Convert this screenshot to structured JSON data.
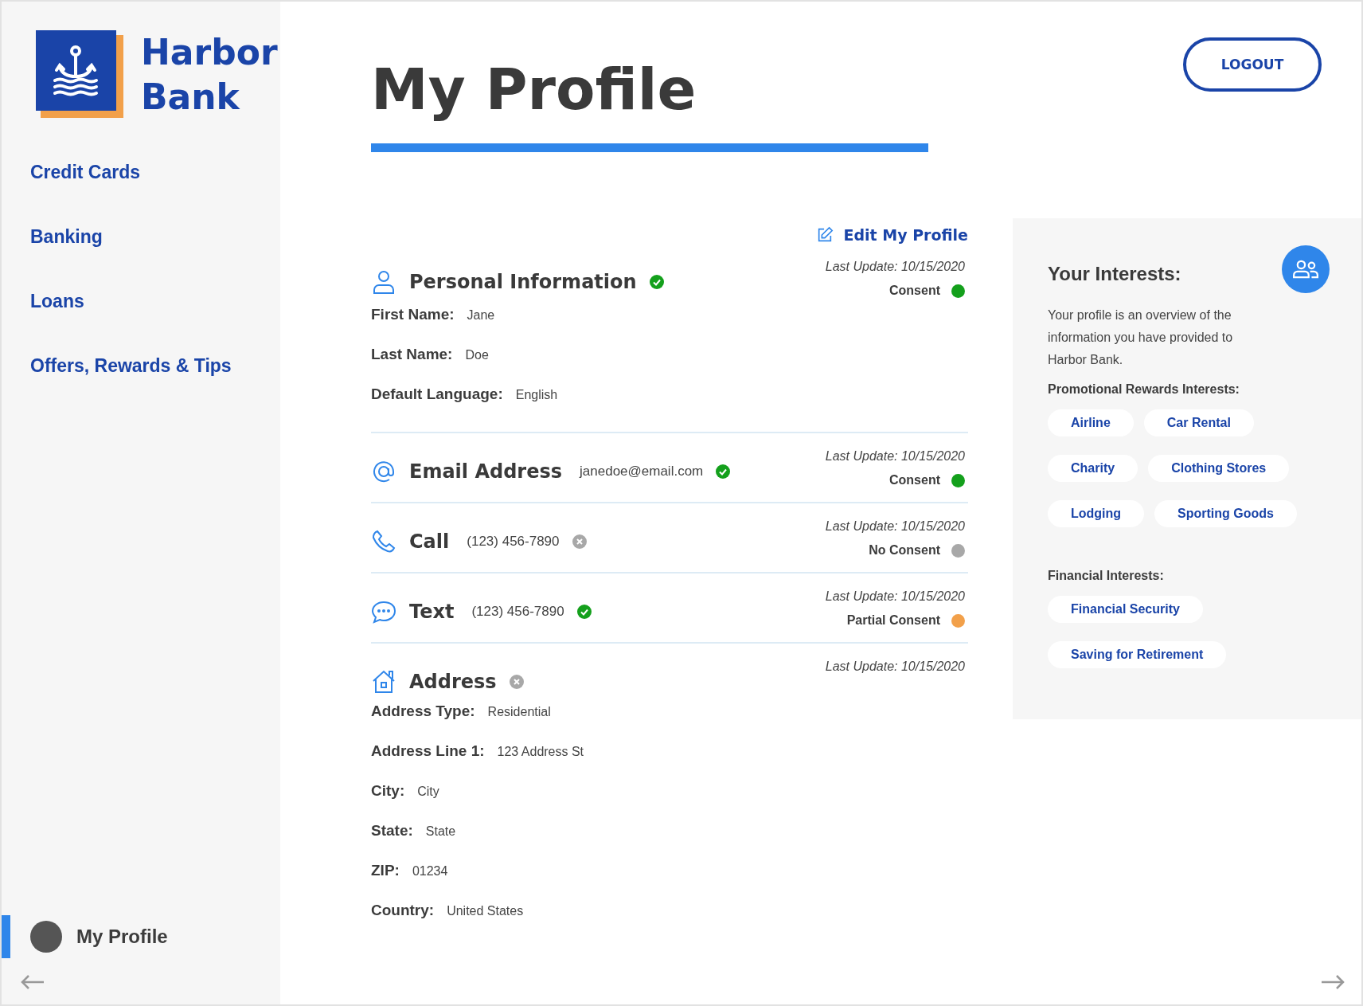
{
  "brand": {
    "name_line_1": "Harbor",
    "name_line_2": "Bank"
  },
  "nav": [
    {
      "label": "Credit Cards",
      "selected": false
    },
    {
      "label": "Banking",
      "selected": false
    },
    {
      "label": "Loans",
      "selected": false
    },
    {
      "label": "Offers, Rewards & Tips",
      "selected": false
    }
  ],
  "profile_link": {
    "label": "My Profile",
    "selected": true
  },
  "page_title": "My Profile",
  "logout_button": "LOGOUT",
  "edit_link": "Edit My Profile",
  "sections": [
    {
      "kind": "person",
      "title": "Personal Information",
      "verified": true,
      "last_update": "Last Update: 10/15/2020",
      "consent": {
        "label": "Consent",
        "color": "#14a01c"
      },
      "fields": [
        {
          "label": "First Name:",
          "value": "Jane"
        },
        {
          "label": "Last Name:",
          "value": "Doe"
        },
        {
          "label": "Default Language:",
          "value": "English"
        }
      ]
    },
    {
      "kind": "email",
      "title": "Email Address",
      "value": "janedoe@email.com",
      "verified": true,
      "last_update": "Last Update: 10/15/2020",
      "consent": {
        "label": "Consent",
        "color": "#14a01c"
      }
    },
    {
      "kind": "phone",
      "title": "Call",
      "value": "(123) 456-7890",
      "verified": false,
      "last_update": "Last Update: 10/15/2020",
      "consent": {
        "label": "No Consent",
        "color": "#a8a8a8"
      }
    },
    {
      "kind": "chat",
      "title": "Text",
      "value": "(123) 456-7890",
      "verified": true,
      "last_update": "Last Update: 10/15/2020",
      "consent": {
        "label": "Partial Consent",
        "color": "#f2a04a"
      }
    },
    {
      "kind": "home",
      "title": "Address",
      "verified": false,
      "last_update": "Last Update: 10/15/2020",
      "fields": [
        {
          "label": "Address Type:",
          "value": "Residential"
        },
        {
          "label": "Address Line 1:",
          "value": "123 Address St"
        },
        {
          "label": "City:",
          "value": "City"
        },
        {
          "label": "State:",
          "value": "State"
        },
        {
          "label": "ZIP:",
          "value": "01234"
        },
        {
          "label": "Country:",
          "value": "United States"
        }
      ]
    }
  ],
  "interests": {
    "title": "Your Interests:",
    "description": "Your profile is an overview of the information you have provided to Harbor Bank.",
    "groups": [
      {
        "heading": "Promotional Rewards Interests:",
        "tags": [
          "Airline",
          "Car Rental",
          "Charity",
          "Clothing Stores",
          "Lodging",
          "Sporting Goods"
        ]
      },
      {
        "heading": "Financial Interests:",
        "tags": [
          "Financial Security",
          "Saving for Retirement"
        ]
      }
    ]
  }
}
